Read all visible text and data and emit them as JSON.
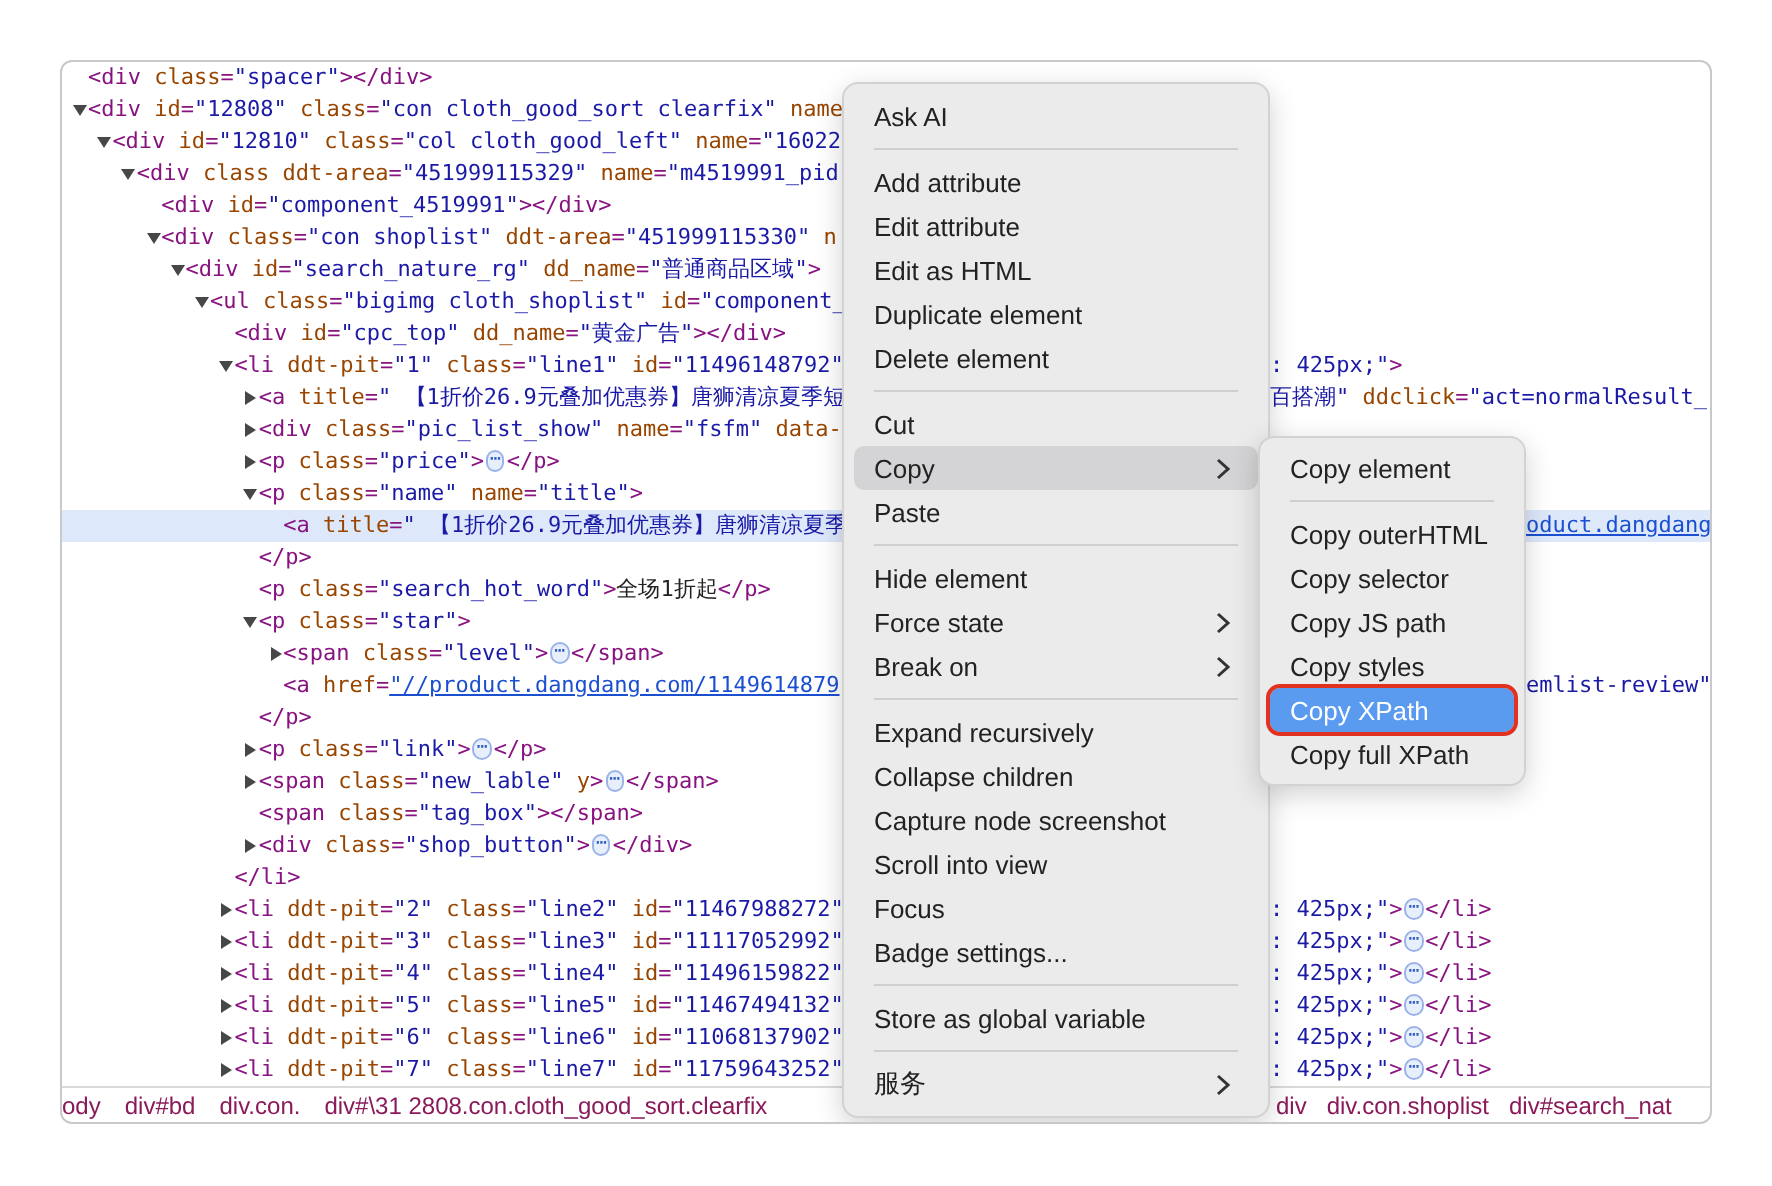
{
  "elements": [
    {
      "text": "<div class=\"spacer\"></div>",
      "selected": false
    },
    {
      "text": "<div id=\"12808\" class=\"con cloth_good_sort clearfix\" name",
      "selected": false,
      "expanded": true,
      "children": [
        {
          "text": "<div id=\"12810\" class=\"col cloth_good_left\" name=\"16022",
          "selected": false,
          "expanded": true,
          "children": [
            {
              "text": "<div class ddt-area=\"451999115329\" name=\"m4519991_pid",
              "selected": false,
              "expanded": true,
              "children": [
                {
                  "text": "<div id=\"component_4519991\"></div>",
                  "selected": false
                },
                {
                  "text": "<div class=\"con shoplist\" ddt-area=\"451999115330\" n",
                  "selected": false,
                  "expanded": true,
                  "children": [
                    {
                      "text": "<div id=\"search_nature_rg\" dd_name=\"普通商品区域\">",
                      "selected": false,
                      "expanded": true,
                      "children": [
                        {
                          "text": "<ul class=\"bigimg cloth_shoplist\" id=\"component_",
                          "selected": false,
                          "expanded": true,
                          "children": [
                            {
                              "text": "<div id=\"cpc_top\" dd_name=\"黄金广告\"></div>",
                              "selected": false
                            },
                            {
                              "text": "<li ddt-pit=\"1\" class=\"line1\" id=\"11496148792\"",
                              "selected": false,
                              "expanded": true,
                              "tail": {
                                "text": ": 425px;\">",
                                "kind": "beside_menu"
                              },
                              "children": [
                                {
                                  "text": "<a title=\" 【1折价26.9元叠加优惠券】唐狮清凉夏季短",
                                  "selected": false,
                                  "expanded": false,
                                  "tail": {
                                    "text": "百搭潮\" ddclick=\"act=normalResult_",
                                    "kind": "beside_menu"
                                  }
                                },
                                {
                                  "text": "<div class=\"pic_list_show\" name=\"fsfm\" data-",
                                  "selected": false,
                                  "expanded": false
                                },
                                {
                                  "text": "<p class=\"price\">⋯</p>",
                                  "selected": false,
                                  "expanded": false
                                },
                                {
                                  "text": "<p class=\"name\" name=\"title\">",
                                  "selected": false,
                                  "expanded": true,
                                  "children": [
                                    {
                                      "text": "<a title=\" 【1折价26.9元叠加优惠券】唐狮清凉夏季",
                                      "selected": true,
                                      "tail": {
                                        "text": "oduct.dangdang",
                                        "kind": "beside_submenu",
                                        "link": true
                                      }
                                    }
                                  ]
                                },
                                {
                                  "text": "</p>",
                                  "selected": false
                                },
                                {
                                  "text": "<p class=\"search_hot_word\">全场1折起</p>",
                                  "selected": false
                                },
                                {
                                  "text": "<p class=\"star\">",
                                  "selected": false,
                                  "expanded": true,
                                  "children": [
                                    {
                                      "text": "<span class=\"level\">⋯</span>",
                                      "selected": false,
                                      "expanded": false
                                    },
                                    {
                                      "text": "<a href=\"//product.dangdang.com/1149614879",
                                      "selected": false,
                                      "link": true,
                                      "tail": {
                                        "text": "emlist-review\"",
                                        "kind": "beside_submenu"
                                      }
                                    }
                                  ]
                                },
                                {
                                  "text": "</p>",
                                  "selected": false
                                },
                                {
                                  "text": "<p class=\"link\">⋯</p>",
                                  "selected": false,
                                  "expanded": false
                                },
                                {
                                  "text": "<span class=\"new_lable\" y>⋯</span>",
                                  "selected": false,
                                  "expanded": false
                                },
                                {
                                  "text": "<span class=\"tag_box\"></span>",
                                  "selected": false
                                },
                                {
                                  "text": "<div class=\"shop_button\">⋯</div>",
                                  "selected": false,
                                  "expanded": false
                                }
                              ]
                            },
                            {
                              "text": "</li>",
                              "selected": false
                            },
                            {
                              "text": "<li ddt-pit=\"2\" class=\"line2\" id=\"11467988272\"",
                              "selected": false,
                              "expanded": false,
                              "tail": {
                                "text": ": 425px;\">⋯</li>",
                                "kind": "beside_menu"
                              }
                            },
                            {
                              "text": "<li ddt-pit=\"3\" class=\"line3\" id=\"11117052992\"",
                              "selected": false,
                              "expanded": false,
                              "tail": {
                                "text": ": 425px;\">⋯</li>",
                                "kind": "beside_menu"
                              }
                            },
                            {
                              "text": "<li ddt-pit=\"4\" class=\"line4\" id=\"11496159822\"",
                              "selected": false,
                              "expanded": false,
                              "tail": {
                                "text": ": 425px;\">⋯</li>",
                                "kind": "beside_menu"
                              }
                            },
                            {
                              "text": "<li ddt-pit=\"5\" class=\"line5\" id=\"11467494132\"",
                              "selected": false,
                              "expanded": false,
                              "tail": {
                                "text": ": 425px;\">⋯</li>",
                                "kind": "beside_menu"
                              }
                            },
                            {
                              "text": "<li ddt-pit=\"6\" class=\"line6\" id=\"11068137902\"",
                              "selected": false,
                              "expanded": false,
                              "tail": {
                                "text": ": 425px;\">⋯</li>",
                                "kind": "beside_menu"
                              }
                            },
                            {
                              "text": "<li ddt-pit=\"7\" class=\"line7\" id=\"11759643252\"",
                              "selected": false,
                              "expanded": false,
                              "tail": {
                                "text": ": 425px;\">⋯</li>",
                                "kind": "beside_menu"
                              }
                            }
                          ]
                        }
                      ]
                    }
                  ]
                }
              ]
            }
          ]
        }
      ]
    }
  ],
  "breadcrumbs": {
    "left": [
      "ody",
      "div#bd",
      "div.con.",
      "div#\\31 2808.con.cloth_good_sort.clearfix"
    ],
    "right": [
      "div",
      "div.con.shoplist",
      "div#search_nat"
    ]
  },
  "context_menu": {
    "items": [
      {
        "kind": "item",
        "label": "Ask AI",
        "selected": false,
        "has_submenu": false
      },
      {
        "kind": "separator"
      },
      {
        "kind": "item",
        "label": "Add attribute",
        "selected": false,
        "has_submenu": false
      },
      {
        "kind": "item",
        "label": "Edit attribute",
        "selected": false,
        "has_submenu": false
      },
      {
        "kind": "item",
        "label": "Edit as HTML",
        "selected": false,
        "has_submenu": false
      },
      {
        "kind": "item",
        "label": "Duplicate element",
        "selected": false,
        "has_submenu": false
      },
      {
        "kind": "item",
        "label": "Delete element",
        "selected": false,
        "has_submenu": false
      },
      {
        "kind": "separator"
      },
      {
        "kind": "item",
        "label": "Cut",
        "selected": false,
        "has_submenu": false
      },
      {
        "kind": "item",
        "label": "Copy",
        "selected": true,
        "has_submenu": true
      },
      {
        "kind": "item",
        "label": "Paste",
        "selected": false,
        "has_submenu": false
      },
      {
        "kind": "separator"
      },
      {
        "kind": "item",
        "label": "Hide element",
        "selected": false,
        "has_submenu": false
      },
      {
        "kind": "item",
        "label": "Force state",
        "selected": false,
        "has_submenu": true
      },
      {
        "kind": "item",
        "label": "Break on",
        "selected": false,
        "has_submenu": true
      },
      {
        "kind": "separator"
      },
      {
        "kind": "item",
        "label": "Expand recursively",
        "selected": false,
        "has_submenu": false
      },
      {
        "kind": "item",
        "label": "Collapse children",
        "selected": false,
        "has_submenu": false
      },
      {
        "kind": "item",
        "label": "Capture node screenshot",
        "selected": false,
        "has_submenu": false
      },
      {
        "kind": "item",
        "label": "Scroll into view",
        "selected": false,
        "has_submenu": false
      },
      {
        "kind": "item",
        "label": "Focus",
        "selected": false,
        "has_submenu": false
      },
      {
        "kind": "item",
        "label": "Badge settings...",
        "selected": false,
        "has_submenu": false
      },
      {
        "kind": "separator"
      },
      {
        "kind": "item",
        "label": "Store as global variable",
        "selected": false,
        "has_submenu": false
      },
      {
        "kind": "separator"
      },
      {
        "kind": "item",
        "label": "服务",
        "selected": false,
        "has_submenu": true
      }
    ]
  },
  "copy_submenu": {
    "items": [
      {
        "kind": "item",
        "label": "Copy element",
        "selected": false,
        "annotated": false
      },
      {
        "kind": "separator"
      },
      {
        "kind": "item",
        "label": "Copy outerHTML",
        "selected": false,
        "annotated": false
      },
      {
        "kind": "item",
        "label": "Copy selector",
        "selected": false,
        "annotated": false
      },
      {
        "kind": "item",
        "label": "Copy JS path",
        "selected": false,
        "annotated": false
      },
      {
        "kind": "item",
        "label": "Copy styles",
        "selected": false,
        "annotated": false
      },
      {
        "kind": "item",
        "label": "Copy XPath",
        "selected": true,
        "annotated": true
      },
      {
        "kind": "item",
        "label": "Copy full XPath",
        "selected": false,
        "annotated": false
      }
    ]
  }
}
